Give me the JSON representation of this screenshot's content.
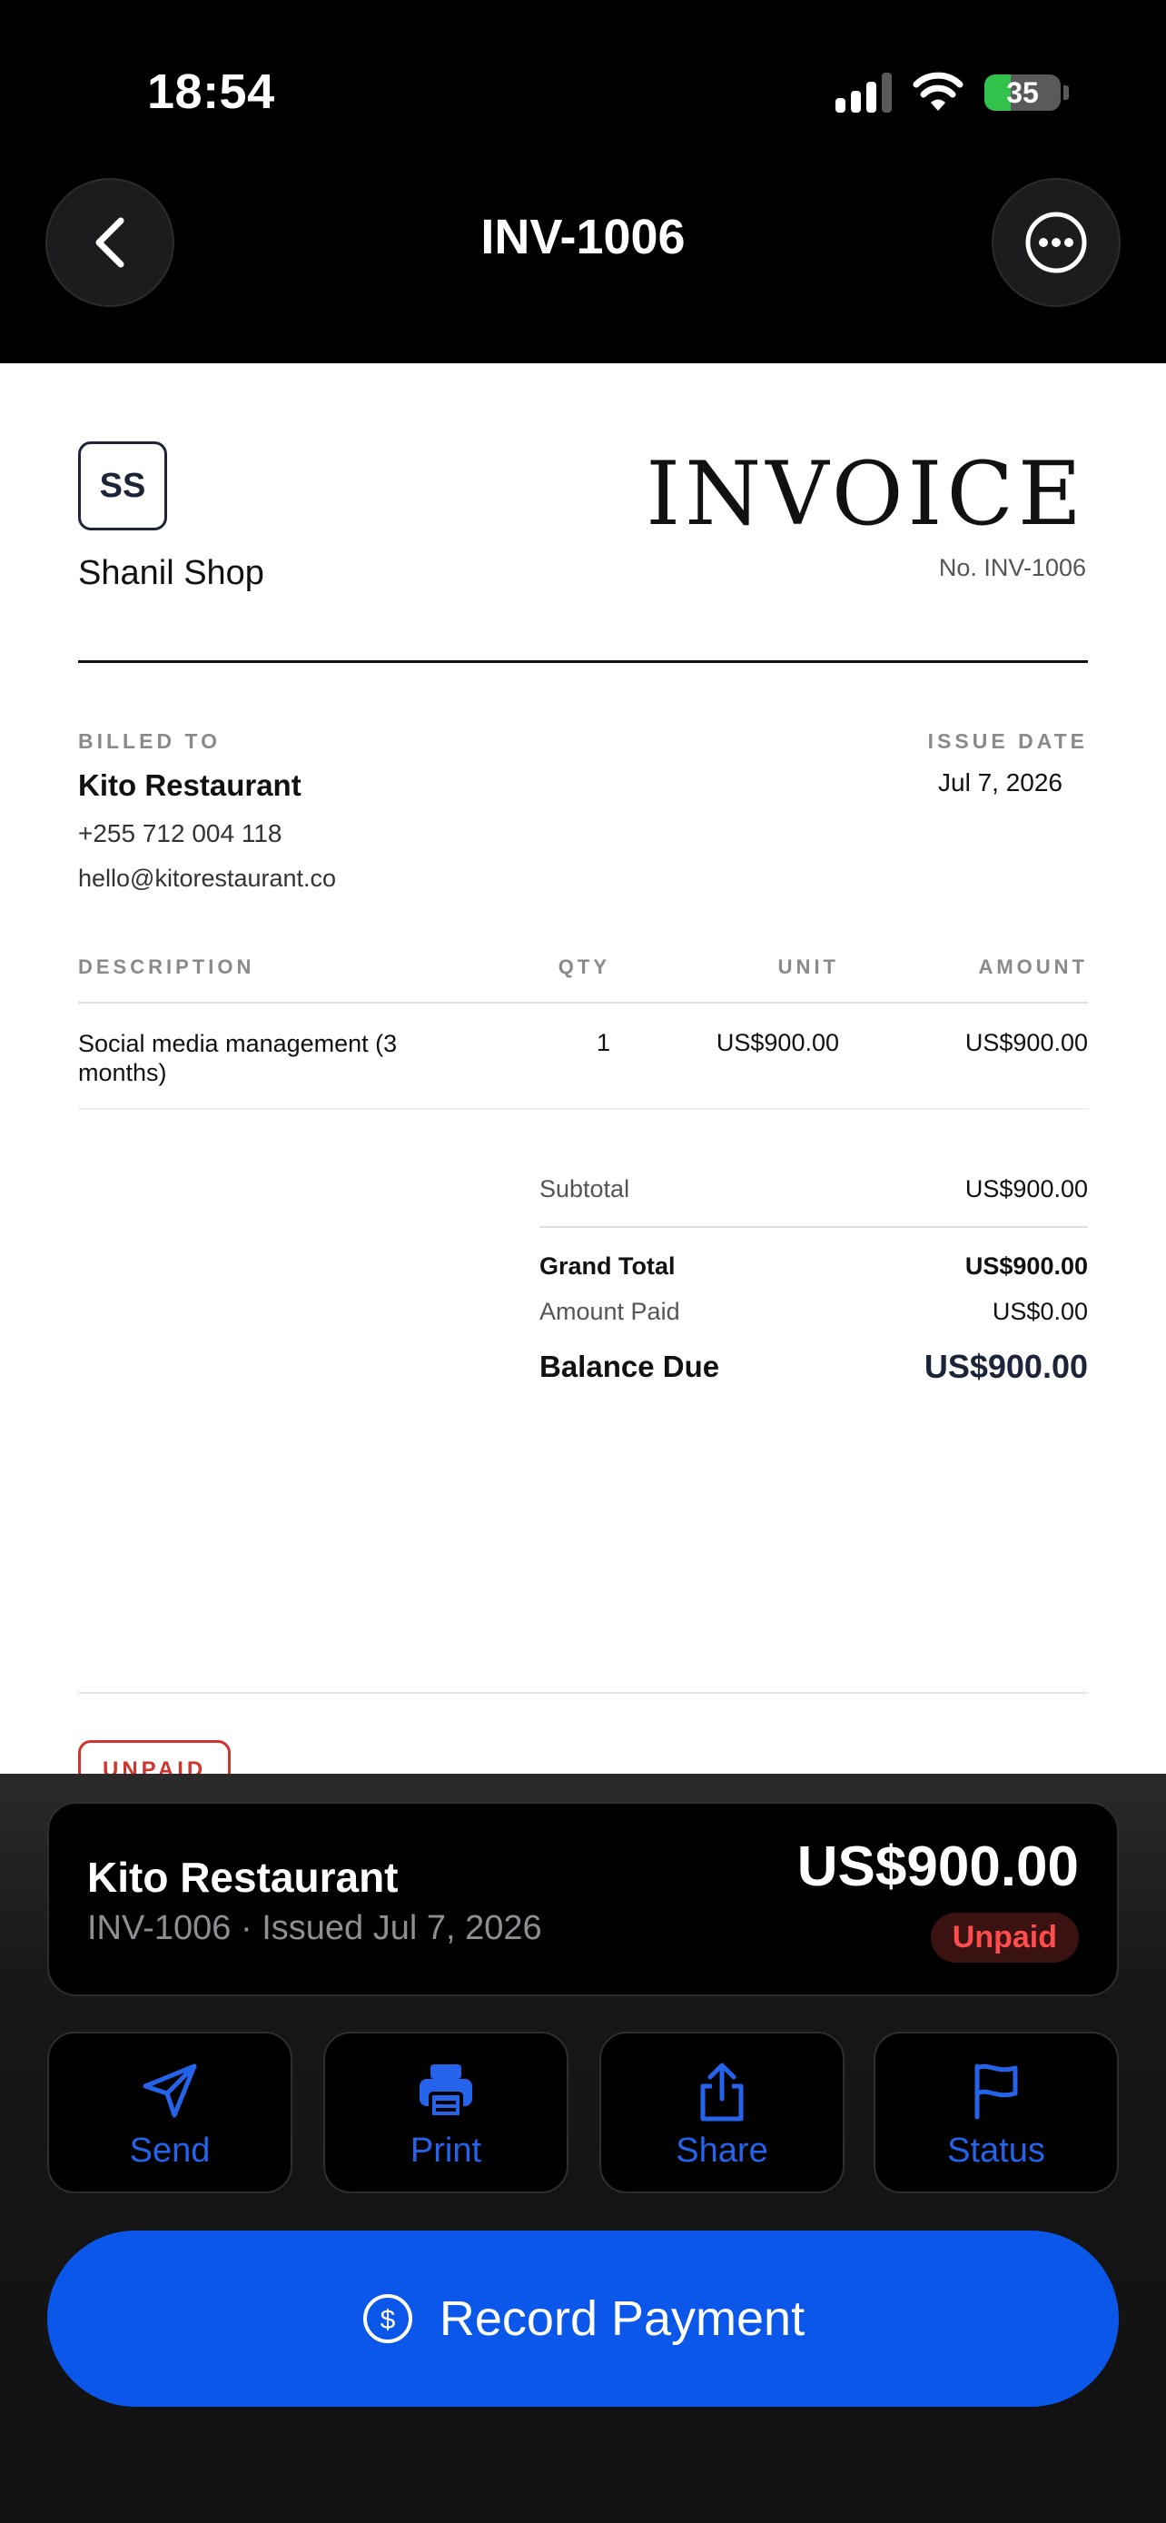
{
  "status_bar": {
    "time": "18:54",
    "battery": "35",
    "battery_level": 0.35
  },
  "header": {
    "title": "INV-1006"
  },
  "invoice": {
    "logo_initials": "SS",
    "shop_name": "Shanil Shop",
    "heading": "INVOICE",
    "number": "No. INV-1006",
    "billed_to_label": "BILLED TO",
    "client_name": "Kito Restaurant",
    "client_phone": "+255 712 004 118",
    "client_email": "hello@kitorestaurant.co",
    "issue_date_label": "ISSUE DATE",
    "issue_date": "Jul 7, 2026",
    "columns": {
      "description": "DESCRIPTION",
      "qty": "QTY",
      "unit": "UNIT",
      "amount": "AMOUNT"
    },
    "items": [
      {
        "description": "Social media management (3 months)",
        "qty": "1",
        "unit": "US$900.00",
        "amount": "US$900.00"
      }
    ],
    "totals": {
      "subtotal_label": "Subtotal",
      "subtotal": "US$900.00",
      "grand_total_label": "Grand Total",
      "grand_total": "US$900.00",
      "amount_paid_label": "Amount Paid",
      "amount_paid": "US$0.00",
      "balance_due_label": "Balance Due",
      "balance_due": "US$900.00"
    },
    "stamp": "UNPAID"
  },
  "summary": {
    "client": "Kito Restaurant",
    "meta": "INV-1006 · Issued Jul 7, 2026",
    "amount": "US$900.00",
    "status": "Unpaid"
  },
  "actions": [
    {
      "label": "Send",
      "icon": "send-icon"
    },
    {
      "label": "Print",
      "icon": "printer-icon"
    },
    {
      "label": "Share",
      "icon": "share-icon"
    },
    {
      "label": "Status",
      "icon": "flag-icon"
    }
  ],
  "record_payment": {
    "label": "Record Payment",
    "icon": "dollar-circle-icon"
  },
  "colors": {
    "accent": "#0b57ea",
    "action_text": "#2563eb",
    "unpaid": "#ff4d4d",
    "battery": "#32c24b"
  }
}
